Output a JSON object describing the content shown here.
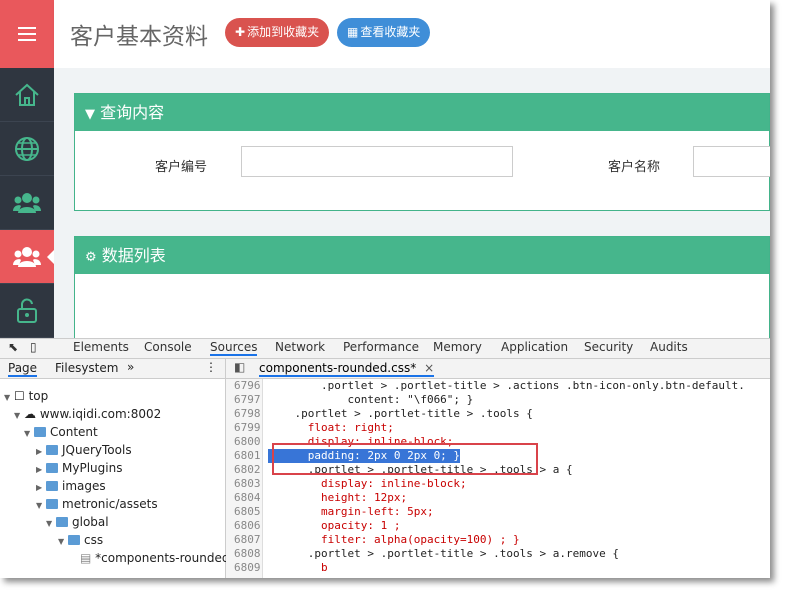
{
  "header": {
    "title": "客户基本资料",
    "add_fav_label": "添加到收藏夹",
    "view_fav_label": "查看收藏夹"
  },
  "sidebar": {
    "icons": [
      "home-icon",
      "globe-icon",
      "users-icon",
      "users-icon-active",
      "unlock-icon"
    ]
  },
  "query_panel": {
    "title": "查询内容",
    "field1_label": "客户编号",
    "field1_value": "",
    "field2_label": "客户名称",
    "field2_value": ""
  },
  "list_panel": {
    "title": "数据列表"
  },
  "devtools": {
    "tabs": [
      "Elements",
      "Console",
      "Sources",
      "Network",
      "Performance",
      "Memory",
      "Application",
      "Security",
      "Audits"
    ],
    "active_tab": "Sources",
    "nav_tabs": [
      "Page",
      "Filesystem",
      "»"
    ],
    "tree": [
      "top",
      "www.iqidi.com:8002",
      "Content",
      "JQueryTools",
      "MyPlugins",
      "images",
      "metronic/assets",
      "global",
      "css",
      "*components-rounded..."
    ],
    "open_file": "components-rounded.css*",
    "lines": [
      {
        "n": "6796",
        "t": "        .portlet > .portlet-title > .actions .btn-icon-only.btn-default."
      },
      {
        "n": "6797",
        "t": "            content: \"\\f066\"; }"
      },
      {
        "n": "6798",
        "t": "    .portlet > .portlet-title > .tools {"
      },
      {
        "n": "6799",
        "t": "      float: right;"
      },
      {
        "n": "6800",
        "t": "      display: inline-block;"
      },
      {
        "n": "6801",
        "t": "      padding: 2px 0 2px 0; }"
      },
      {
        "n": "6802",
        "t": "      .portlet > .portlet-title > .tools > a {"
      },
      {
        "n": "6803",
        "t": "        display: inline-block;"
      },
      {
        "n": "6804",
        "t": "        height: 12px;"
      },
      {
        "n": "6805",
        "t": "        margin-left: 5px;"
      },
      {
        "n": "6806",
        "t": "        opacity: 1 ;"
      },
      {
        "n": "6807",
        "t": "        filter: alpha(opacity=100) ; }"
      },
      {
        "n": "6808",
        "t": "      .portlet > .portlet-title > .tools > a.remove {"
      },
      {
        "n": "6809",
        "t": "        b"
      }
    ]
  }
}
